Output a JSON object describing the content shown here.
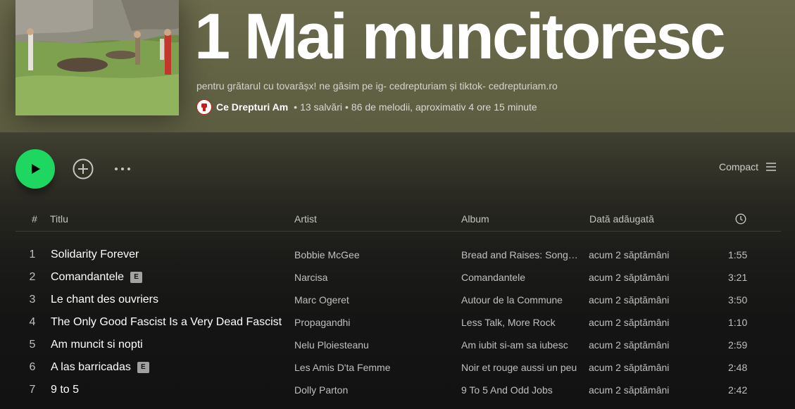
{
  "playlist": {
    "title": "1 Mai muncitoresc",
    "description": "pentru grătarul cu tovarășx! ne găsim pe ig- cedrepturiam și tiktok- cedrepturiam.ro",
    "owner": "Ce Drepturi Am",
    "saves": "13 salvări",
    "stats": "86 de melodii, aproximativ 4 ore 15 minute"
  },
  "controls": {
    "view_mode": "Compact",
    "play_icon": "play-icon",
    "add_icon": "plus-circle-icon",
    "more_icon": "more-horizontal-icon",
    "list_icon": "list-icon"
  },
  "table": {
    "headers": {
      "num": "#",
      "title": "Titlu",
      "artist": "Artist",
      "album": "Album",
      "date": "Dată adăugată",
      "duration_icon": "clock-icon"
    },
    "rows": [
      {
        "num": "1",
        "title": "Solidarity Forever",
        "explicit": false,
        "artist": "Bobbie McGee",
        "album": "Bread and Raises: Songs...",
        "date": "acum 2 săptămâni",
        "duration": "1:55"
      },
      {
        "num": "2",
        "title": "Comandantele",
        "explicit": true,
        "artist": "Narcisa",
        "album": "Comandantele",
        "date": "acum 2 săptămâni",
        "duration": "3:21"
      },
      {
        "num": "3",
        "title": "Le chant des ouvriers",
        "explicit": false,
        "artist": "Marc Ogeret",
        "album": "Autour de la Commune",
        "date": "acum 2 săptămâni",
        "duration": "3:50"
      },
      {
        "num": "4",
        "title": "The Only Good Fascist Is a Very Dead Fascist",
        "explicit": false,
        "artist": "Propagandhi",
        "album": "Less Talk, More Rock",
        "date": "acum 2 săptămâni",
        "duration": "1:10"
      },
      {
        "num": "5",
        "title": "Am muncit si nopti",
        "explicit": false,
        "artist": "Nelu Ploiesteanu",
        "album": "Am iubit si-am sa iubesc",
        "date": "acum 2 săptămâni",
        "duration": "2:59"
      },
      {
        "num": "6",
        "title": "A las barricadas",
        "explicit": true,
        "artist": "Les Amis D'ta Femme",
        "album": "Noir et rouge aussi un peu",
        "date": "acum 2 săptămâni",
        "duration": "2:48"
      },
      {
        "num": "7",
        "title": "9 to 5",
        "explicit": false,
        "artist": "Dolly Parton",
        "album": "9 To 5 And Odd Jobs",
        "date": "acum 2 săptămâni",
        "duration": "2:42"
      }
    ],
    "explicit_label": "E"
  },
  "colors": {
    "accent": "#1ed760",
    "header_bg": "#6b6a4c"
  }
}
